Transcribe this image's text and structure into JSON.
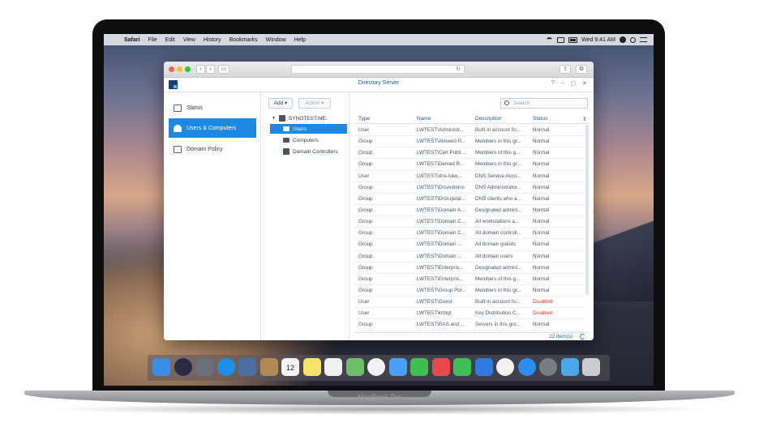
{
  "device": {
    "brand": "MacBook Pro"
  },
  "menubar": {
    "apple": "",
    "items": [
      "Safari",
      "File",
      "Edit",
      "View",
      "History",
      "Bookmarks",
      "Window",
      "Help"
    ],
    "clock": "Wed 9:41 AM"
  },
  "safari": {
    "back": "‹",
    "forward": "›",
    "sidebar": "▭",
    "reload": "↻",
    "share": "⇪",
    "tabs": "⧉",
    "address": ""
  },
  "app": {
    "title": "Directory Server",
    "controls": [
      "?",
      "–",
      "▢",
      "✕"
    ],
    "sidebar": [
      {
        "label": "Status",
        "icon": "status-icon"
      },
      {
        "label": "Users & Computers",
        "icon": "users-icon",
        "active": true
      },
      {
        "label": "Domain Policy",
        "icon": "policy-icon"
      }
    ],
    "toolbar": {
      "add": "Add ▾",
      "action": "Action ▾"
    },
    "tree": {
      "domain": "SYNOTEST.ME",
      "children": [
        "Users",
        "Computers",
        "Domain Controllers"
      ]
    },
    "search": {
      "placeholder": "Search"
    },
    "grid": {
      "columns": [
        "Type",
        "Name",
        "Description",
        "Status"
      ],
      "rows": [
        {
          "type": "User",
          "name": "LWTEST\\Administr...",
          "desc": "Built-in account fo...",
          "status": "Normal"
        },
        {
          "type": "Group",
          "name": "LWTEST\\Allowed R...",
          "desc": "Members in this gr...",
          "status": "Normal"
        },
        {
          "type": "Group",
          "name": "LWTEST\\Cert Publi...",
          "desc": "Members of this g...",
          "status": "Normal"
        },
        {
          "type": "Group",
          "name": "LWTEST\\Denied R...",
          "desc": "Members in this gr...",
          "status": "Normal"
        },
        {
          "type": "User",
          "name": "LWTEST\\dns-luke...",
          "desc": "DNS Service Acco...",
          "status": "Normal"
        },
        {
          "type": "Group",
          "name": "LWTEST\\DnsAdmins",
          "desc": "DNS Administrator...",
          "status": "Normal"
        },
        {
          "type": "Group",
          "name": "LWTEST\\DnsUpdat...",
          "desc": "DNS clients who a...",
          "status": "Normal"
        },
        {
          "type": "Group",
          "name": "LWTEST\\Domain A...",
          "desc": "Designated admini...",
          "status": "Normal"
        },
        {
          "type": "Group",
          "name": "LWTEST\\Domain C...",
          "desc": "All workstations a...",
          "status": "Normal"
        },
        {
          "type": "Group",
          "name": "LWTEST\\Domain C...",
          "desc": "All domain controll...",
          "status": "Normal"
        },
        {
          "type": "Group",
          "name": "LWTEST\\Domain ...",
          "desc": "All domain guests",
          "status": "Normal"
        },
        {
          "type": "Group",
          "name": "LWTEST\\Domain ...",
          "desc": "All domain users",
          "status": "Normal"
        },
        {
          "type": "Group",
          "name": "LWTEST\\Enterpris...",
          "desc": "Designated admini...",
          "status": "Normal"
        },
        {
          "type": "Group",
          "name": "LWTEST\\Enterpris...",
          "desc": "Members of this g...",
          "status": "Normal"
        },
        {
          "type": "Group",
          "name": "LWTEST\\Group Pol...",
          "desc": "Members in this gr...",
          "status": "Normal"
        },
        {
          "type": "User",
          "name": "LWTEST\\Guest",
          "desc": "Built-in account fo...",
          "status": "Disabled"
        },
        {
          "type": "User",
          "name": "LWTEST\\krbtgt",
          "desc": "Key Distribution C...",
          "status": "Disabled"
        },
        {
          "type": "Group",
          "name": "LWTEST\\RAS and ...",
          "desc": "Servers in this gro...",
          "status": "Normal"
        }
      ],
      "count": "22 item(s)"
    }
  },
  "dock": {
    "icons": [
      "finder-icon",
      "siri-icon",
      "launchpad-icon",
      "safari-icon",
      "photos-viewer-icon",
      "contacts-icon",
      "calendar-icon",
      "notes-icon",
      "reminders-icon",
      "maps-icon",
      "photos-icon",
      "messages-icon",
      "facetime-icon",
      "news-icon",
      "numbers-icon",
      "keynote-icon",
      "music-icon",
      "app-store-icon",
      "system-preferences-icon",
      "downloads-icon",
      "trash-icon"
    ],
    "colors": [
      "#3a8ee6",
      "#2a2a44",
      "#6b6f7a",
      "#1e8fe8",
      "#4a6ea0",
      "#b08a55",
      "#f4f4f4",
      "#f6e36a",
      "#f0f0f0",
      "#6fbf6a",
      "#f2f2f2",
      "#4a9ff5",
      "#3fbf4f",
      "#e84a4a",
      "#3fbf5a",
      "#2f7be0",
      "#f2f2f2",
      "#2d8ef0",
      "#7a7d84",
      "#4aa8e8",
      "#c9cdd3"
    ],
    "calendar_day": "12"
  }
}
